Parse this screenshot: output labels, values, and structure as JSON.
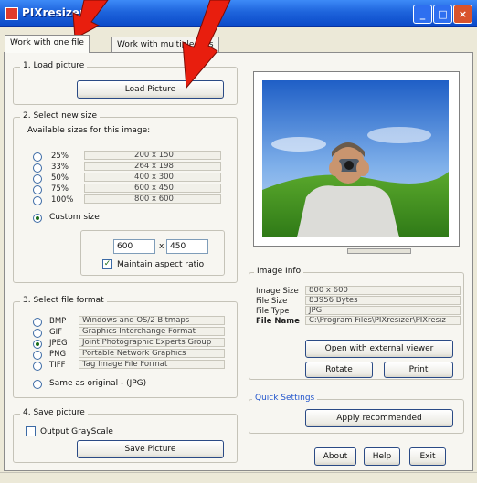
{
  "window": {
    "title": "PIXresizer"
  },
  "tabs": [
    {
      "label": "Work with one file"
    },
    {
      "label": "Work with multiple files"
    }
  ],
  "load": {
    "section_title": "1. Load picture",
    "button_label": "Load Picture"
  },
  "size": {
    "section_title": "2. Select new size",
    "available_label": "Available sizes for this image:",
    "options": [
      {
        "percent": "25%",
        "dims": "200 x 150"
      },
      {
        "percent": "33%",
        "dims": "264 x 198"
      },
      {
        "percent": "50%",
        "dims": "400 x 300"
      },
      {
        "percent": "75%",
        "dims": "600 x 450"
      },
      {
        "percent": "100%",
        "dims": "800 x 600"
      }
    ],
    "custom_label": "Custom size",
    "width_value": "600",
    "separator": "x",
    "height_value": "450",
    "aspect_label": "Maintain aspect ratio",
    "aspect_checked": true
  },
  "format": {
    "section_title": "3. Select file format",
    "options": [
      {
        "name": "BMP",
        "desc": "Windows and OS/2 Bitmaps"
      },
      {
        "name": "GIF",
        "desc": "Graphics Interchange Format"
      },
      {
        "name": "JPEG",
        "desc": "Joint Photographic Experts Group"
      },
      {
        "name": "PNG",
        "desc": "Portable Network Graphics"
      },
      {
        "name": "TIFF",
        "desc": "Tag Image File Format"
      }
    ],
    "selected": "JPEG",
    "same_as_original": "Same as original - (JPG)"
  },
  "save": {
    "section_title": "4. Save picture",
    "grayscale_label": "Output GrayScale",
    "button_label": "Save Picture"
  },
  "image_info": {
    "section_title": "Image Info",
    "rows": [
      {
        "label": "Image Size",
        "value": "800 x 600"
      },
      {
        "label": "File Size",
        "value": "83956 Bytes"
      },
      {
        "label": "File Type",
        "value": "JPG"
      },
      {
        "label": "File Name",
        "value": "C:\\Program Files\\PIXresizer\\PIXresiz"
      }
    ],
    "open_external_label": "Open with external viewer",
    "rotate_label": "Rotate",
    "print_label": "Print"
  },
  "quick": {
    "section_title": "Quick Settings",
    "apply_label": "Apply recommended"
  },
  "footer": {
    "about_label": "About",
    "help_label": "Help",
    "exit_label": "Exit"
  },
  "colors": {
    "titlebar": "#1e64dc",
    "quick_title": "#2255cc",
    "arrow": "#e81e0e"
  }
}
